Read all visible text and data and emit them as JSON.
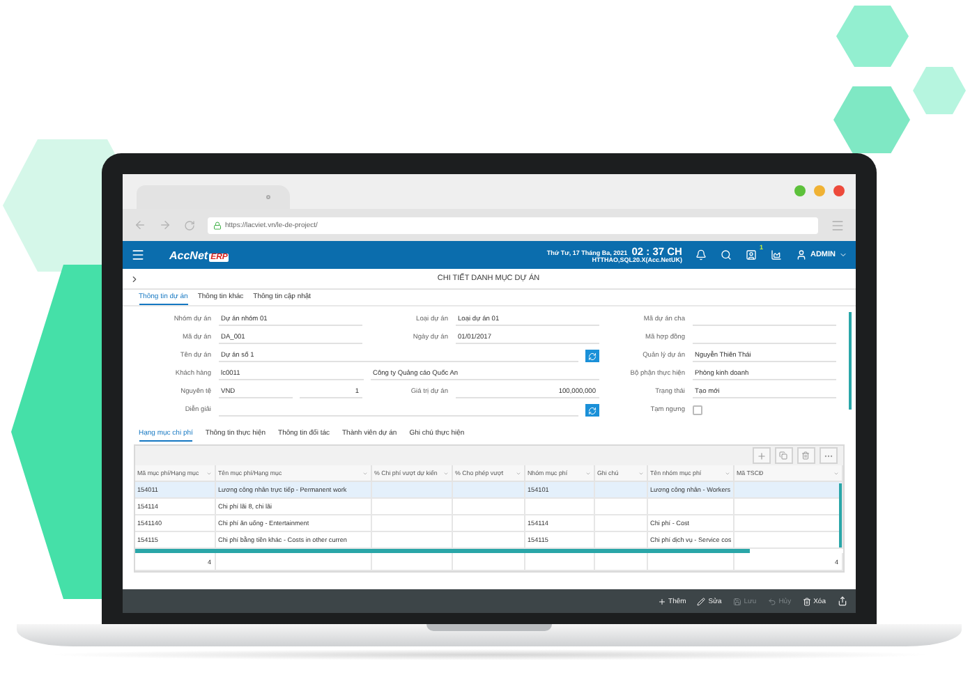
{
  "browser": {
    "url": "https://lacviet.vn/le-de-project/"
  },
  "app_header": {
    "logo_name": "AccNet",
    "logo_suffix": "ERP",
    "date": "Thứ Tư, 17 Tháng Ba, 2021",
    "time": "02 : 37 CH",
    "server": "HTTHAO,SQL20.X(Acc.NetUK)",
    "notification_count": "1",
    "user": "ADMIN"
  },
  "page_title": "CHI TIẾT DANH MỤC DỰ ÁN",
  "tabs": [
    {
      "label": "Thông tin dự án",
      "selected": true
    },
    {
      "label": "Thông tin khác",
      "selected": false
    },
    {
      "label": "Thông tin cập nhật",
      "selected": false
    }
  ],
  "form": {
    "rows": [
      [
        {
          "label": "Nhóm dự án",
          "value": "Dự án nhóm 01",
          "kind": "text"
        },
        {
          "label": "Loại dự án",
          "value": "Loại dự án 01",
          "kind": "text"
        },
        {
          "label": "Mã dự án cha",
          "kind": "text"
        }
      ],
      [
        {
          "label": "Mã dự án",
          "value": "DA_001",
          "kind": "text"
        },
        {
          "label": "Ngày dự án",
          "value": "01/01/2017",
          "kind": "text"
        },
        {
          "label": "Mã hợp đồng",
          "kind": "text"
        }
      ],
      [
        {
          "label": "Tên dự án",
          "value": "Dự án số 1",
          "kind": "lookup"
        },
        {
          "label": "Quản lý dự án",
          "value": "Nguyễn Thiên Thái",
          "kind": "text"
        }
      ],
      [
        {
          "label": "Khách hàng",
          "value": "lc0011",
          "extra": "Công ty Quảng cáo Quốc An",
          "kind": "pair"
        },
        {
          "label": "Bộ phận thực hiện",
          "value": "Phòng kinh doanh",
          "kind": "text"
        }
      ],
      [
        {
          "label": "Nguyên tệ",
          "value": "VND",
          "extra": "1",
          "kind": "rate"
        },
        {
          "label": "Giá trị dự án",
          "value": "100,000,000",
          "kind": "amount"
        },
        {
          "label": "Trạng thái",
          "value": "Tạo mới",
          "kind": "text"
        }
      ],
      [
        {
          "label": "Diễn giải",
          "kind": "lookup"
        },
        {
          "label": "Tạm ngưng",
          "kind": "checkbox",
          "checked": false
        }
      ]
    ]
  },
  "detail_tabs": [
    {
      "label": "Hạng mục chi phí",
      "selected": true
    },
    {
      "label": "Thông tin thực hiện",
      "selected": false
    },
    {
      "label": "Thông tin đối tác",
      "selected": false
    },
    {
      "label": "Thành viên dự án",
      "selected": false
    },
    {
      "label": "Ghi chú thực hiện",
      "selected": false
    }
  ],
  "table": {
    "columns": [
      "Mã mục phí/Hạng mục",
      "Tên mục phí/Hạng mục",
      "% Chi phí vượt dự kiến",
      "% Cho phép vượt",
      "Nhóm mục phí",
      "Ghi chú",
      "Tên nhóm mục phí",
      "Mã TSCĐ"
    ],
    "rows": [
      {
        "selected": true,
        "cells": [
          "154011",
          "Lương công nhân trực tiếp - Permanent work",
          null,
          null,
          "154101",
          null,
          "Lương công nhân - Workers",
          null
        ]
      },
      {
        "selected": false,
        "cells": [
          "154114",
          "Chi phí lãi 8, chi lãi",
          null,
          null,
          null,
          null,
          null,
          null
        ]
      },
      {
        "selected": false,
        "cells": [
          "1541140",
          "Chi phí ăn uống - Entertainment",
          null,
          null,
          "154114",
          null,
          "Chi phí - Cost",
          null
        ]
      },
      {
        "selected": false,
        "cells": [
          "154115",
          "Chi phí bằng tiền khác - Costs in other curren",
          null,
          null,
          "154115",
          null,
          "Chi phí dịch vụ - Service cos",
          null
        ]
      }
    ],
    "footer": {
      "first_total": "4",
      "last_total": "4"
    }
  },
  "toolbar": [
    {
      "label": "Thêm",
      "kind": "add",
      "disabled": false
    },
    {
      "label": "Sửa",
      "kind": "edit",
      "disabled": false
    },
    {
      "label": "Lưu",
      "kind": "save",
      "disabled": true
    },
    {
      "label": "Hủy",
      "kind": "undo",
      "disabled": true
    },
    {
      "label": "Xóa",
      "kind": "delete",
      "disabled": false
    }
  ]
}
